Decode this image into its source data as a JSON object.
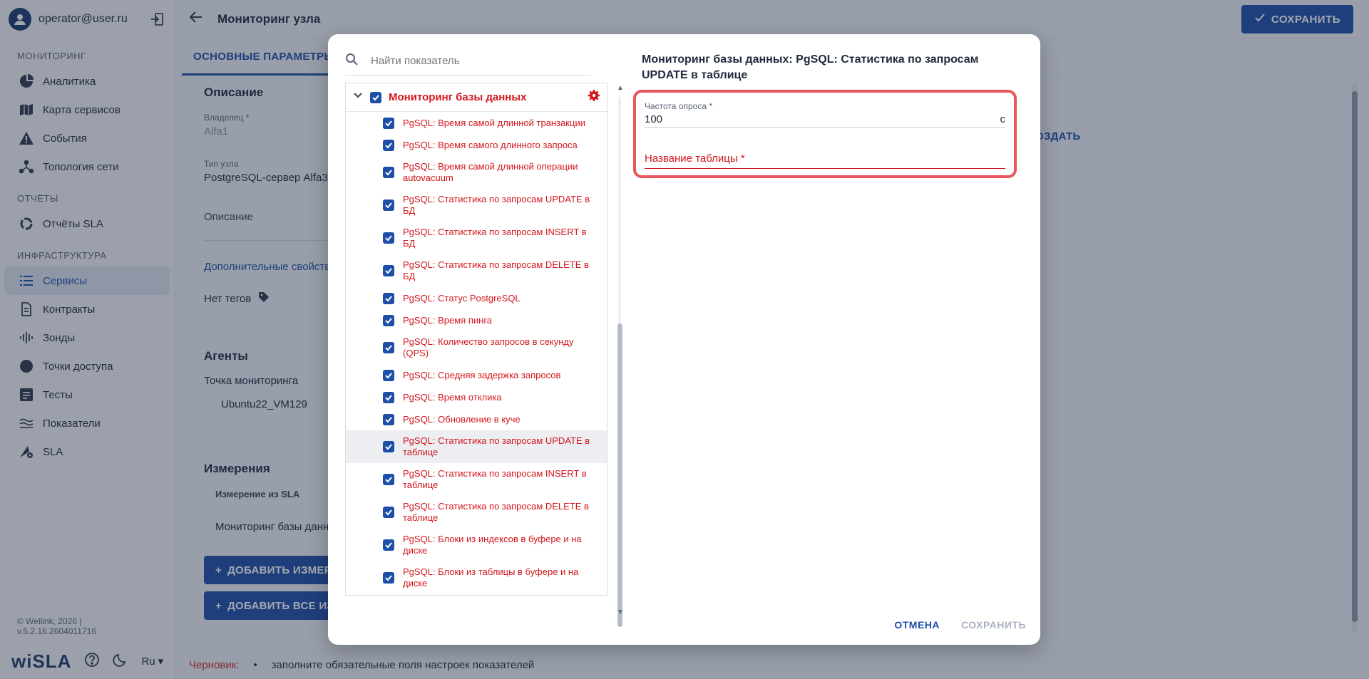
{
  "sidebar": {
    "user_email": "operator@user.ru",
    "sections": {
      "monitoring": "МОНИТОРИНГ",
      "reports": "ОТЧЁТЫ",
      "infrastructure": "ИНФРАСТРУКТУРА"
    },
    "items": {
      "analytics": "Аналитика",
      "service_map": "Карта сервисов",
      "events": "События",
      "topology": "Топология сети",
      "sla_reports": "Отчёты SLA",
      "services": "Сервисы",
      "contracts": "Контракты",
      "probes": "Зонды",
      "access_points": "Точки доступа",
      "tests": "Тесты",
      "indicators": "Показатели",
      "sla": "SLA"
    },
    "copyright": "© Wellink, 2026 | v.5.2.16.2604011716",
    "brand": "wiSLA",
    "lang": "Ru"
  },
  "header": {
    "title": "Мониторинг узла",
    "save_label": "СОХРАНИТЬ"
  },
  "tabs": {
    "main_params": "ОСНОВНЫЕ ПАРАМЕТРЫ"
  },
  "main": {
    "description_title": "Описание",
    "owner_label": "Владелец *",
    "owner_value": "Alfa1",
    "node_type_label": "Тип узла",
    "node_type_value": "PostgreSQL-сервер Alfa3",
    "description_field": "Описание",
    "extra_props": "Дополнительные свойства",
    "no_tags": "Нет тегов",
    "agents_title": "Агенты",
    "monitoring_point": "Точка мониторинга",
    "agent_value": "Ubuntu22_VM129",
    "measurements_title": "Измерения",
    "measurement_header": "Измерение из SLA",
    "measurement_row": "Мониторинг базы данн",
    "add_measurement": "ДОБАВИТЬ ИЗМЕР",
    "add_all": "ДОБАВИТЬ ВСЕ ИЗ",
    "create_link": "ОЗДАТЬ"
  },
  "status": {
    "draft_label": "Черновик:",
    "message": "заполните обязательные поля настроек показателей"
  },
  "dialog": {
    "search_placeholder": "Найти показатель",
    "group_title": "Мониторинг базы данных",
    "items": [
      "PgSQL: Время самой длинной транзакции",
      "PgSQL: Время самого длинного запроса",
      "PgSQL: Время самой длинной операции autovacuum",
      "PgSQL: Статистика по запросам UPDATE в БД",
      "PgSQL: Статистика по запросам INSERT в БД",
      "PgSQL: Статистика по запросам DELETE в БД",
      "PgSQL: Статус PostgreSQL",
      "PgSQL: Время пинга",
      "PgSQL: Количество запросов в секунду (QPS)",
      "PgSQL: Средняя задержка запросов",
      "PgSQL: Время отклика",
      "PgSQL: Обновление в куче",
      "PgSQL: Статистика по запросам UPDATE в таблице",
      "PgSQL: Статистика по запросам INSERT в таблице",
      "PgSQL: Статистика по запросам DELETE в таблице",
      "PgSQL: Блоки из индексов в буфере и на диске",
      "PgSQL: Блоки из таблицы в буфере и на диске"
    ],
    "detail_title": "Мониторинг базы данных: PgSQL: Статистика по запросам UPDATE в таблице",
    "poll_label": "Частота опроса *",
    "poll_value": "100",
    "poll_unit": "с",
    "table_name_label": "Название таблицы *",
    "cancel_label": "ОТМЕНА",
    "save_label": "СОХРАНИТЬ"
  }
}
